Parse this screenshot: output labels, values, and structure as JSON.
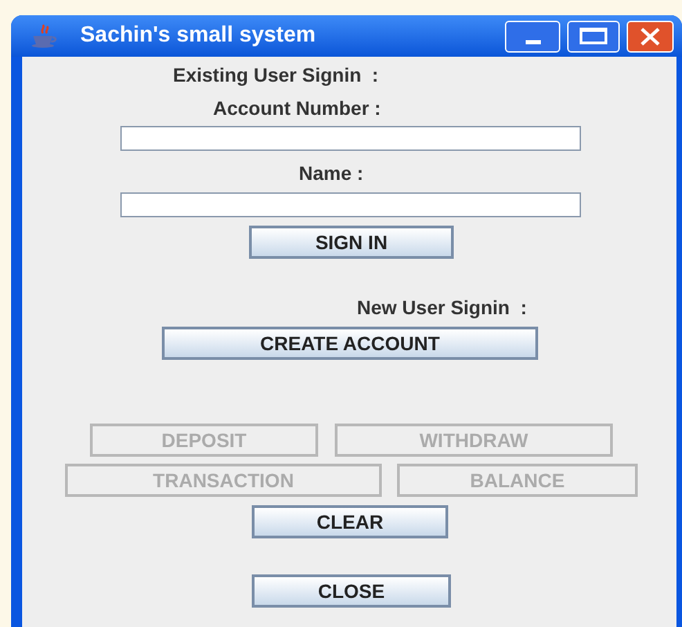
{
  "window": {
    "title": "Sachin's small system"
  },
  "existing_user": {
    "heading": "Existing User Signin  :",
    "account_label": "Account Number :",
    "name_label": "Name :",
    "sign_in": {
      "label": "SIGN IN",
      "disabled": false
    }
  },
  "new_user": {
    "heading": "New User Signin  :",
    "create_account": {
      "label": "CREATE ACCOUNT",
      "disabled": false
    }
  },
  "actions": [
    {
      "label": "DEPOSIT",
      "disabled": true
    },
    {
      "label": "WITHDRAW",
      "disabled": true
    },
    {
      "label": "TRANSACTION",
      "disabled": true
    },
    {
      "label": "BALANCE",
      "disabled": true
    },
    {
      "label": "CLEAR",
      "disabled": false
    },
    {
      "label": "CLOSE",
      "disabled": false
    }
  ]
}
